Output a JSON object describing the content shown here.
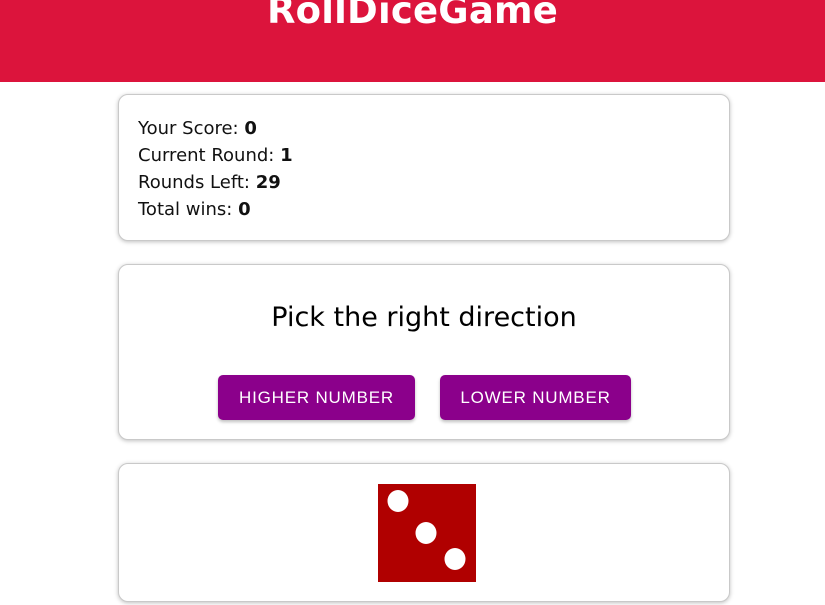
{
  "header": {
    "title": "RollDiceGame",
    "background": "#dc143c"
  },
  "stats": {
    "score_label": "Your Score: ",
    "score_value": "0",
    "round_label": "Current Round: ",
    "round_value": "1",
    "rounds_left_label": "Rounds Left: ",
    "rounds_left_value": "29",
    "wins_label": "Total wins: ",
    "wins_value": "0"
  },
  "pick": {
    "title": "Pick the right direction",
    "higher_label": "Higher Number",
    "lower_label": "Lower Number",
    "button_color": "#8b008b"
  },
  "dice": {
    "value": 3,
    "color": "#b00000",
    "pip_color": "#ffffff",
    "icon": "die-face-3-icon"
  }
}
